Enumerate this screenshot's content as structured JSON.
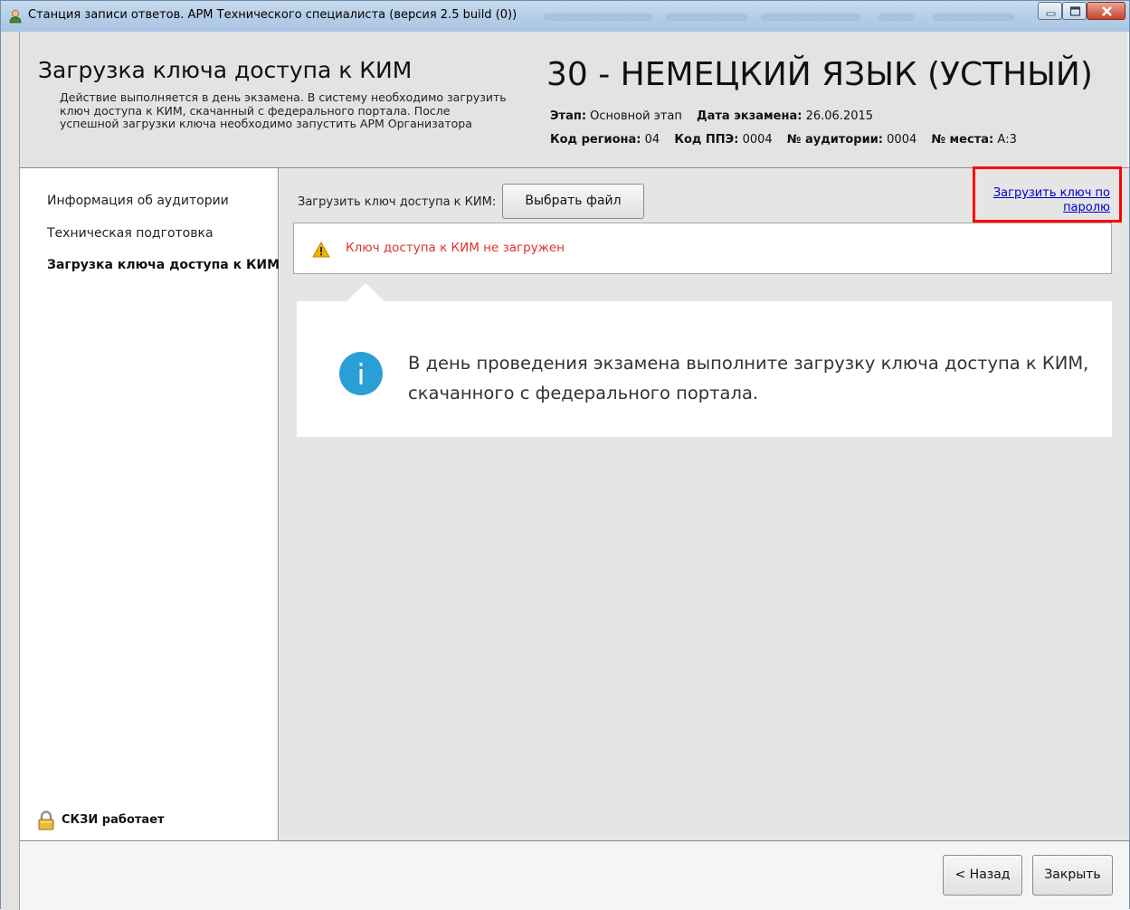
{
  "window": {
    "title": "Станция записи ответов. АРМ Технического специалиста (версия 2.5 build (0))"
  },
  "header": {
    "title": "Загрузка ключа доступа к КИМ",
    "description": "Действие выполняется в день экзамена. В систему необходимо загрузить ключ доступа к КИМ, скачанный с федерального портала. После успешной загрузки ключа необходимо запустить АРМ Организатора",
    "subject": "30 - НЕМЕЦКИЙ ЯЗЫК (УСТНЫЙ)",
    "stage_label": "Этап:",
    "stage_value": "Основной этап",
    "date_label": "Дата экзамена:",
    "date_value": "26.06.2015",
    "region_label": "Код региона:",
    "region_value": "04",
    "ppe_label": "Код ППЭ:",
    "ppe_value": "0004",
    "auditorium_label": "№ аудитории:",
    "auditorium_value": "0004",
    "seat_label": "№ места:",
    "seat_value": "А:3"
  },
  "sidebar": {
    "items": [
      {
        "label": "Информация об аудитории"
      },
      {
        "label": "Техническая подготовка"
      },
      {
        "label": "Загрузка ключа доступа к КИМ",
        "active": true
      }
    ],
    "skzi_status": "СКЗИ работает"
  },
  "main": {
    "load_label": "Загрузить ключ доступа к КИМ:",
    "choose_file_button": "Выбрать файл",
    "password_link_line1": "Загрузить ключ по",
    "password_link_line2": "паролю",
    "status_message": "Ключ доступа к КИМ не загружен",
    "info_text": "В день проведения экзамена выполните загрузку ключа доступа к КИМ, скачанного с федерального портала."
  },
  "footer": {
    "back_button": "< Назад",
    "close_button": "Закрыть"
  },
  "colors": {
    "error_text": "#e0302a",
    "link": "#0000cc",
    "highlight": "#ff0000",
    "info_icon": "#2a9fd6",
    "warning_icon": "#f0b400"
  }
}
